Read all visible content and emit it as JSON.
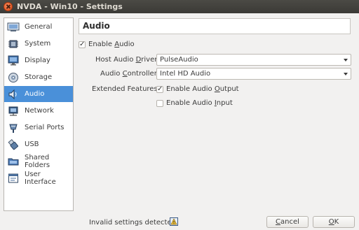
{
  "window": {
    "title": "NVDA - Win10 - Settings"
  },
  "sidebar": {
    "items": [
      {
        "label": "General",
        "icon": "general-icon"
      },
      {
        "label": "System",
        "icon": "system-chip-icon"
      },
      {
        "label": "Display",
        "icon": "display-monitor-icon"
      },
      {
        "label": "Storage",
        "icon": "storage-disk-icon"
      },
      {
        "label": "Audio",
        "icon": "audio-speaker-icon",
        "selected": true
      },
      {
        "label": "Network",
        "icon": "network-icon"
      },
      {
        "label": "Serial Ports",
        "icon": "serial-port-icon"
      },
      {
        "label": "USB",
        "icon": "usb-icon"
      },
      {
        "label": "Shared Folders",
        "icon": "shared-folder-icon"
      },
      {
        "label": "User Interface",
        "icon": "user-interface-icon"
      }
    ]
  },
  "panel": {
    "title": "Audio",
    "enable_audio": {
      "pre": "Enable ",
      "accel": "A",
      "post": "udio",
      "checked": true
    },
    "host_driver": {
      "pre": "Host Audio ",
      "accel": "D",
      "post": "river:",
      "value": "PulseAudio"
    },
    "controller": {
      "pre": "Audio ",
      "accel": "C",
      "post": "ontroller:",
      "value": "Intel HD Audio"
    },
    "extended_features_label": "Extended Features:",
    "enable_output": {
      "pre": "Enable Audio ",
      "accel": "O",
      "post": "utput",
      "checked": true
    },
    "enable_input": {
      "pre": "Enable Audio ",
      "accel": "I",
      "post": "nput",
      "checked": false
    }
  },
  "status": {
    "text": "Invalid settings detected",
    "icon": "warning-icon"
  },
  "buttons": {
    "cancel": {
      "accel": "C",
      "rest": "ancel"
    },
    "ok": {
      "accel": "O",
      "rest": "K"
    }
  },
  "colors": {
    "selection": "#4a90d9",
    "titlebar": "#3c3b37",
    "close": "#e5561d"
  }
}
